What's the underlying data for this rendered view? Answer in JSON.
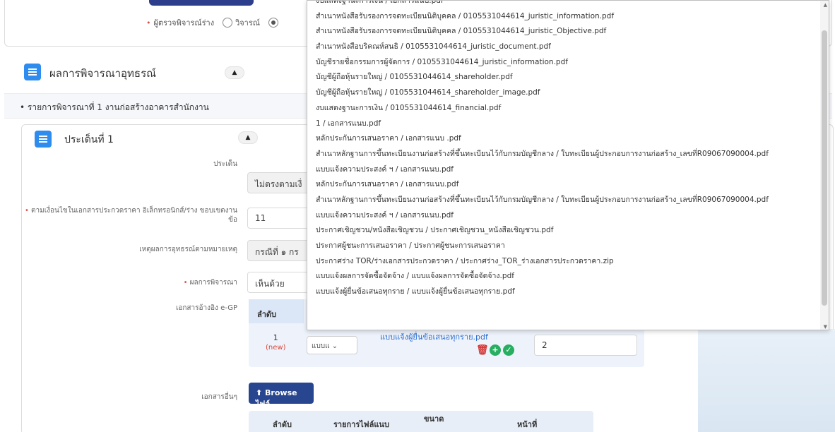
{
  "top": {
    "consider_label": "ผู้ตรวจพิจารณ์ร่าง",
    "option_label": "วิจารณ์"
  },
  "section": {
    "title": "ผลการพิจารณาอุทธรณ์",
    "collapse_icon": "caret-up",
    "appeal_item": "รายการพิจารณาที่ 1 งานก่อสร้างอาคารสำนักงาน"
  },
  "issue": {
    "title": "ประเด็นที่ 1",
    "fields": [
      {
        "label": "ประเด็น",
        "value": "ไม่ตรงตามเงื่",
        "required": false
      },
      {
        "label": "ตามเงื่อนไขในเอกสารประกวดราคา อิเล็กทรอนิกส์/ร่าง ขอบเขตงาน ข้อ",
        "value": "11",
        "required": true
      },
      {
        "label": "เหตุผลการอุทธรณ์ตามหมายเหตุ",
        "value": "กรณีที่ ๑ กร",
        "required": false
      },
      {
        "label": "ผลการพิจารณา",
        "value": "เห็นด้วย",
        "required": true
      }
    ],
    "ref_label": "เอกสารอ้างอิง e-GP",
    "ref_table": {
      "col_order": "ลำดับ",
      "row_no": "1",
      "row_new": "(new)",
      "select_value": "แบบแ",
      "file_link": "แบบแจ้งผู้ยื่นข้อเสนอทุกราย.pdf",
      "page": "2"
    },
    "other_label": "เอกสารอื่นๆ",
    "browse_label": "Browse ไฟล์",
    "other_table": {
      "col_order": "ลำดับ",
      "col_file": "รายการไฟล์แนบ",
      "col_size": "ขนาด",
      "col_page": "หน้าที่"
    }
  },
  "dropdown": {
    "selected_index": 21,
    "items": [
      "งบแสดงฐานะการเงิน / เอกสารแนบ.pdf",
      "สำเนาหนังสือรับรองการจดทะเบียนนิติบุคคล / 0105531044614_juristic_information.pdf",
      "สำเนาหนังสือรับรองการจดทะเบียนนิติบุคคล / 0105531044614_juristic_Objective.pdf",
      "สำเนาหนังสือบริคณห์สนธิ / 0105531044614_juristic_document.pdf",
      "บัญชีรายชื่อกรรมการผู้จัดการ / 0105531044614_juristic_information.pdf",
      "บัญชีผู้ถือหุ้นรายใหญ่ / 0105531044614_shareholder.pdf",
      "บัญชีผู้ถือหุ้นรายใหญ่ / 0105531044614_shareholder_image.pdf",
      "งบแสดงฐานะการเงิน / 0105531044614_financial.pdf",
      "1 / เอกสารแนบ.pdf",
      "หลักประกันการเสนอราคา / เอกสารแนบ .pdf",
      "สำเนาหลักฐานการขึ้นทะเบียนงานก่อสร้างที่ขึ้นทะเบียนไว้กับกรมบัญชีกลาง / ใบทะเบียนผู้ประกอบการงานก่อสร้าง_เลขที่R09067090004.pdf",
      "แบบแจ้งความประสงค์ ฯ / เอกสารแนบ.pdf",
      "หลักประกันการเสนอราคา / เอกสารแนบ.pdf",
      "สำเนาหลักฐานการขึ้นทะเบียนงานก่อสร้างที่ขึ้นทะเบียนไว้กับกรมบัญชีกลาง / ใบทะเบียนผู้ประกอบการงานก่อสร้าง_เลขที่R09067090004.pdf",
      "แบบแจ้งความประสงค์ ฯ / เอกสารแนบ.pdf",
      "ประกาศเชิญชวน/หนังสือเชิญชวน / ประกาศเชิญชวน_หนังสือเชิญชวน.pdf",
      "ประกาศผู้ชนะการเสนอราคา / ประกาศผู้ชนะการเสนอราคา",
      "ประกาศร่าง TOR/ร่างเอกสารประกวดราคา / ประกาศร่าง_TOR_ร่างเอกสารประกวดราคา.zip",
      "แบบแจ้งผลการจัดซื้อจัดจ้าง / แบบแจ้งผลการจัดซื้อจัดจ้าง.pdf",
      "แบบแจ้งผู้ยื่นข้อเสนอทุกราย / แบบแจ้งผู้ยื่นข้อเสนอทุกราย.pdf"
    ]
  }
}
